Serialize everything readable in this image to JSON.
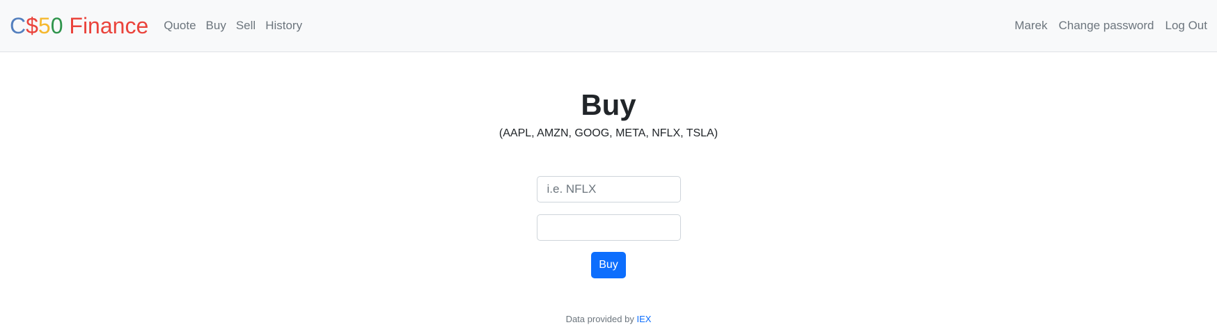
{
  "brand": {
    "c": "C",
    "dollar": "$",
    "five": "5",
    "zero": "0",
    "finance": " Finance",
    "colors": {
      "c": "#537fbe",
      "dollar": "#ea433b",
      "five": "#f5b82e",
      "zero": "#2e944b",
      "finance": "#ea433b"
    }
  },
  "nav": {
    "left": [
      "Quote",
      "Buy",
      "Sell",
      "History"
    ],
    "right": [
      "Marek",
      "Change password",
      "Log Out"
    ]
  },
  "main": {
    "title": "Buy",
    "subtitle": "(AAPL, AMZN, GOOG, META, NFLX, TSLA)",
    "symbol_placeholder": "i.e. NFLX",
    "symbol_value": "",
    "shares_value": "",
    "button": "Buy"
  },
  "footer": {
    "text": "Data provided by ",
    "link": "IEX"
  }
}
